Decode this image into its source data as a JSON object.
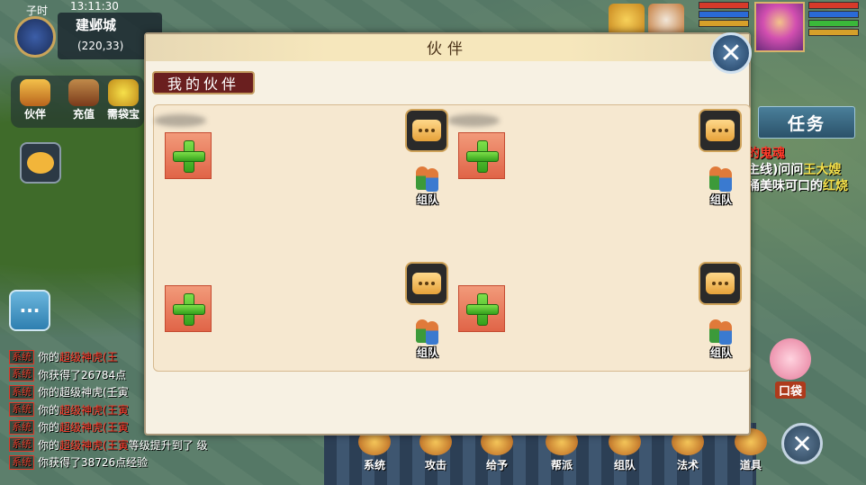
{
  "hud": {
    "time_period": "子时",
    "clock": "13:11:30",
    "city": "建邺城",
    "coords": "(220,33)",
    "left_buttons": [
      "伙伴",
      "充值",
      "需袋宝"
    ],
    "task_label": "任务",
    "quest_lines": [
      {
        "pre": "",
        "mid": "的鬼魂",
        "post": ""
      },
      {
        "pre": "主线)问问",
        "mid": "王大嫂",
        "post": ""
      },
      {
        "pre": "桶美味可口的",
        "mid": "红烧",
        "post": ""
      }
    ],
    "bag_label": "口袋"
  },
  "chat": {
    "tag": "系统",
    "lines": [
      {
        "pre": "你的",
        "red": "超级神虎(王",
        "post": ""
      },
      {
        "pre": "你获得了26784点",
        "red": "",
        "post": ""
      },
      {
        "pre": "你的超级神虎(壬寅",
        "red": "",
        "post": ""
      },
      {
        "pre": "你的",
        "red": "超级神虎(王寅",
        "post": ""
      },
      {
        "pre": "你的",
        "red": "超级神虎(王寅",
        "post": ""
      },
      {
        "pre": "你的",
        "red": "超级神虎(王寅",
        "post": "等级提升到了  级"
      },
      {
        "pre": "你获得了38726点经验",
        "red": "",
        "post": ""
      }
    ]
  },
  "bottom_bar": [
    "系统",
    "攻击",
    "给予",
    "帮派",
    "组队",
    "法术",
    "道具"
  ],
  "dialog": {
    "title": "伙伴",
    "section": "我的伙伴",
    "team_label": "组队"
  },
  "colors": {
    "dialog_bg": "#f7f1e3",
    "section_bg": "#6a1f1f",
    "add_button": "#e06448",
    "plus_green": "#34a01c",
    "quest_red": "#ff3a2a",
    "quest_yellow": "#f4e04a"
  }
}
